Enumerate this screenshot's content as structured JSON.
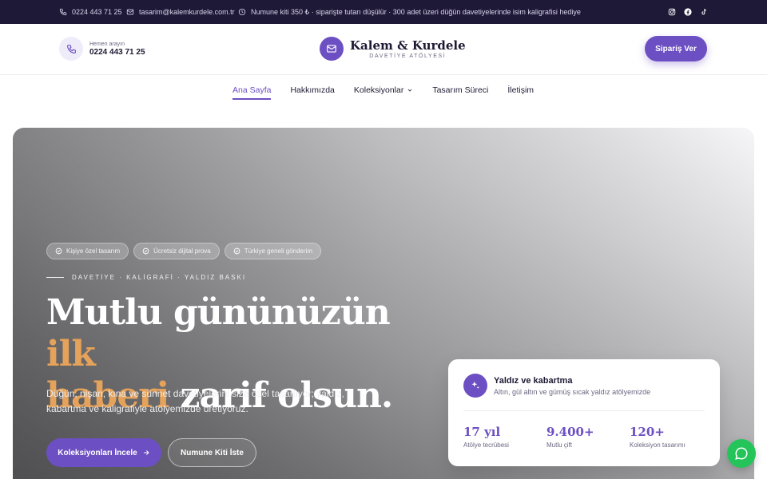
{
  "topbar": {
    "phone": "0224 443 71 25",
    "email": "tasarim@kalemkurdele.com.tr",
    "notice": "Numune kiti 350 ₺ · siparişte tutarı düşülür · 300 adet üzeri düğün davetiyelerinde isim kaligrafisi hediye",
    "social": [
      "instagram-icon",
      "facebook-icon",
      "tiktok-icon"
    ]
  },
  "header": {
    "call_label": "Hemen arayın",
    "call_number": "0224 443 71 25",
    "brand_name": "Kalem & Kurdele",
    "brand_sub": "DAVETİYE ATÖLYESİ",
    "order_button": "Sipariş Ver"
  },
  "nav": {
    "items": [
      "Ana Sayfa",
      "Hakkımızda",
      "Koleksiyonlar",
      "Tasarım Süreci",
      "İletişim"
    ]
  },
  "hero": {
    "chips": [
      "Kişiye özel tasarım",
      "Ücretsiz dijital prova",
      "Türkiye geneli gönderim"
    ],
    "eyebrow": "DAVETİYE · KALİGRAFİ · YALDIZ BASKI",
    "headline_part1": "Mutlu gününüzün ",
    "headline_accent1": "ilk",
    "headline_accent2": "haberi",
    "headline_part2": " zarif olsun.",
    "lead": "Düğün, nişan, kına ve sünnet davetiyelerini size özel tasarlıyor; yaldız, kabartma ve kaligrafiyle atölyemizde üretiyoruz.",
    "primary_button": "Koleksiyonları İncele",
    "secondary_button": "Numune Kiti İste"
  },
  "card": {
    "title": "Yaldız ve kabartma",
    "subtitle": "Altın, gül altın ve gümüş sıcak yaldız atölyemizde",
    "stats": [
      {
        "value": "17 yıl",
        "label": "Atölye tecrübesi"
      },
      {
        "value": "9.400+",
        "label": "Mutlu çift"
      },
      {
        "value": "120+",
        "label": "Koleksiyon tasarımı"
      }
    ]
  },
  "colors": {
    "accent": "#6c4fc2",
    "gold": "#e5a25a",
    "topbar": "#1f1938",
    "chat": "#25c45a"
  }
}
